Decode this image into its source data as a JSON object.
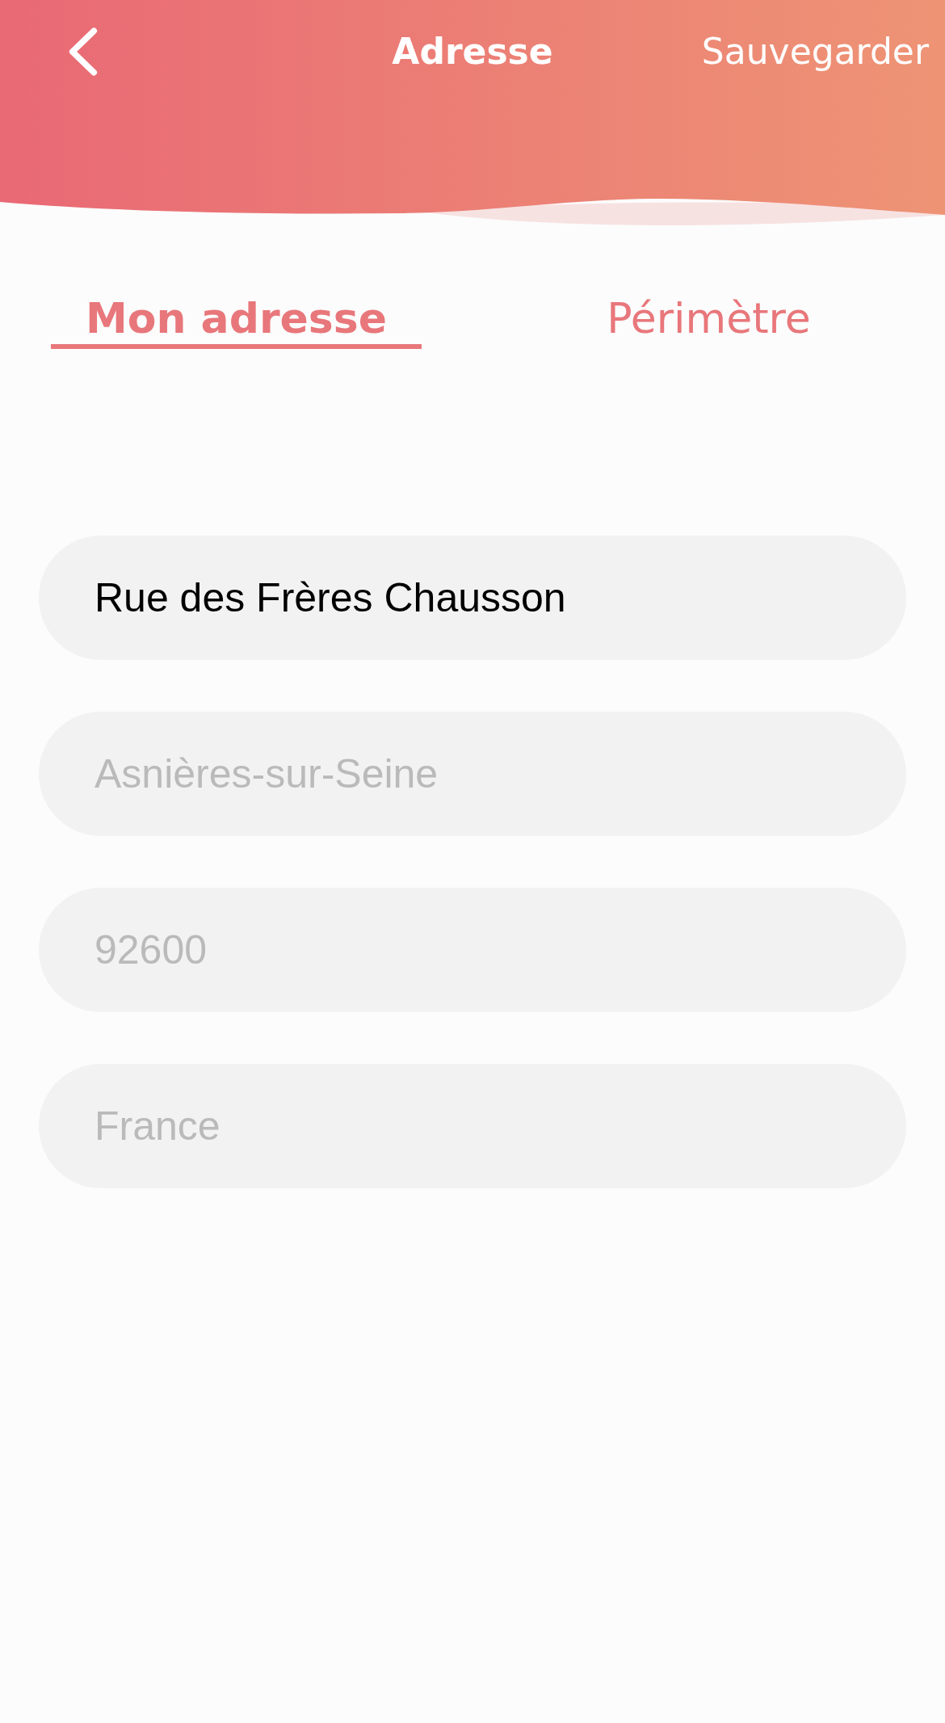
{
  "header": {
    "title": "Adresse",
    "action": "Sauvegarder"
  },
  "tabs": [
    {
      "label": "Mon adresse",
      "selected": true
    },
    {
      "label": "Périmètre",
      "selected": false
    }
  ],
  "fields": [
    {
      "value": "Rue des Frères Chausson"
    },
    {
      "placeholder": "Asnières-sur-Seine"
    },
    {
      "placeholder": "92600"
    },
    {
      "placeholder": "France"
    }
  ]
}
